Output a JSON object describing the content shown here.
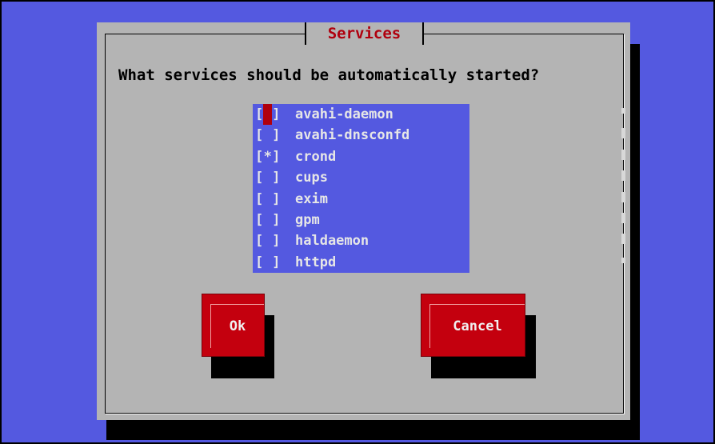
{
  "dialog": {
    "title": "Services",
    "prompt": "What services should be automatically started?"
  },
  "services": [
    {
      "checkbox": "[ ]",
      "name": "avahi-daemon",
      "checked": false,
      "focused": true
    },
    {
      "checkbox": "[ ]",
      "name": "avahi-dnsconfd",
      "checked": false
    },
    {
      "checkbox": "[*]",
      "name": "crond",
      "checked": true
    },
    {
      "checkbox": "[ ]",
      "name": "cups",
      "checked": false
    },
    {
      "checkbox": "[ ]",
      "name": "exim",
      "checked": false
    },
    {
      "checkbox": "[ ]",
      "name": "gpm",
      "checked": false
    },
    {
      "checkbox": "[ ]",
      "name": "haldaemon",
      "checked": false
    },
    {
      "checkbox": "[ ]",
      "name": "httpd",
      "checked": false
    }
  ],
  "buttons": {
    "ok_label": "Ok",
    "cancel_label": "Cancel"
  },
  "colors": {
    "background": "#5459e0",
    "dialog": "#b4b4b4",
    "title_text": "#b0000e",
    "button": "#c4000e",
    "list_text": "#e6e6e6"
  }
}
